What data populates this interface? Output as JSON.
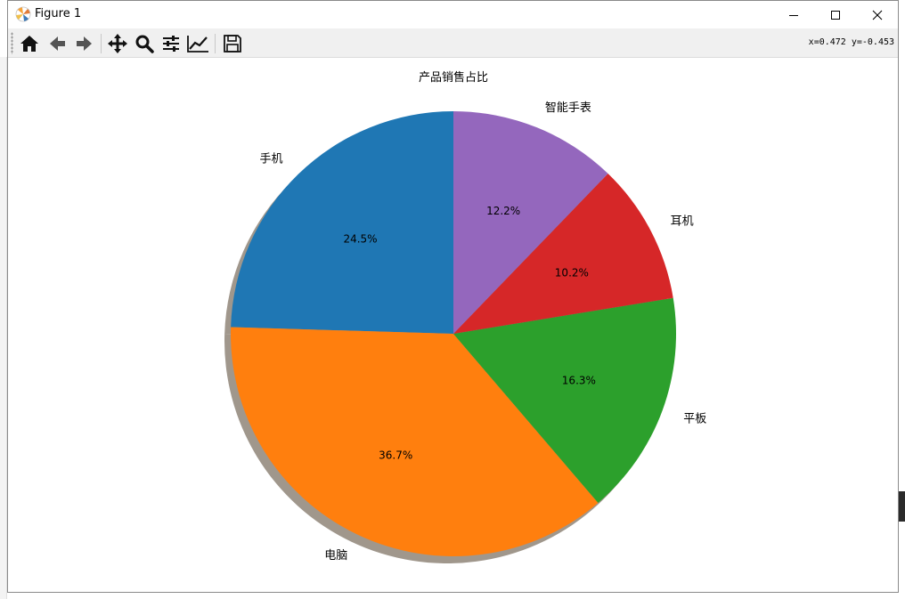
{
  "window": {
    "title": "Figure 1",
    "icon": "matplotlib-icon",
    "controls": [
      "minimize-icon",
      "maximize-icon",
      "close-icon"
    ]
  },
  "toolbar": {
    "tools": [
      "home-icon",
      "back-arrow-icon",
      "forward-arrow-icon",
      "pan-icon",
      "zoom-icon",
      "configure-subplots-icon",
      "edit-axis-icon",
      "save-icon"
    ],
    "coords": "x=0.472 y=-0.453"
  },
  "colors": {
    "phone": "#1f77b4",
    "computer": "#ff7f0e",
    "tablet": "#2ca02c",
    "earphones": "#d62728",
    "smartwatch": "#9467bd",
    "shadow": "#a0978c"
  },
  "chart_data": {
    "type": "pie",
    "title": "产品销售占比",
    "categories": [
      "手机",
      "电脑",
      "平板",
      "耳机",
      "智能手表"
    ],
    "values": [
      24.5,
      36.7,
      16.3,
      10.2,
      12.2
    ],
    "value_labels": [
      "24.5%",
      "36.7%",
      "16.3%",
      "10.2%",
      "12.2%"
    ],
    "start_angle_deg": 90,
    "direction": "counterclockwise",
    "shadow": true,
    "legend": "none"
  }
}
